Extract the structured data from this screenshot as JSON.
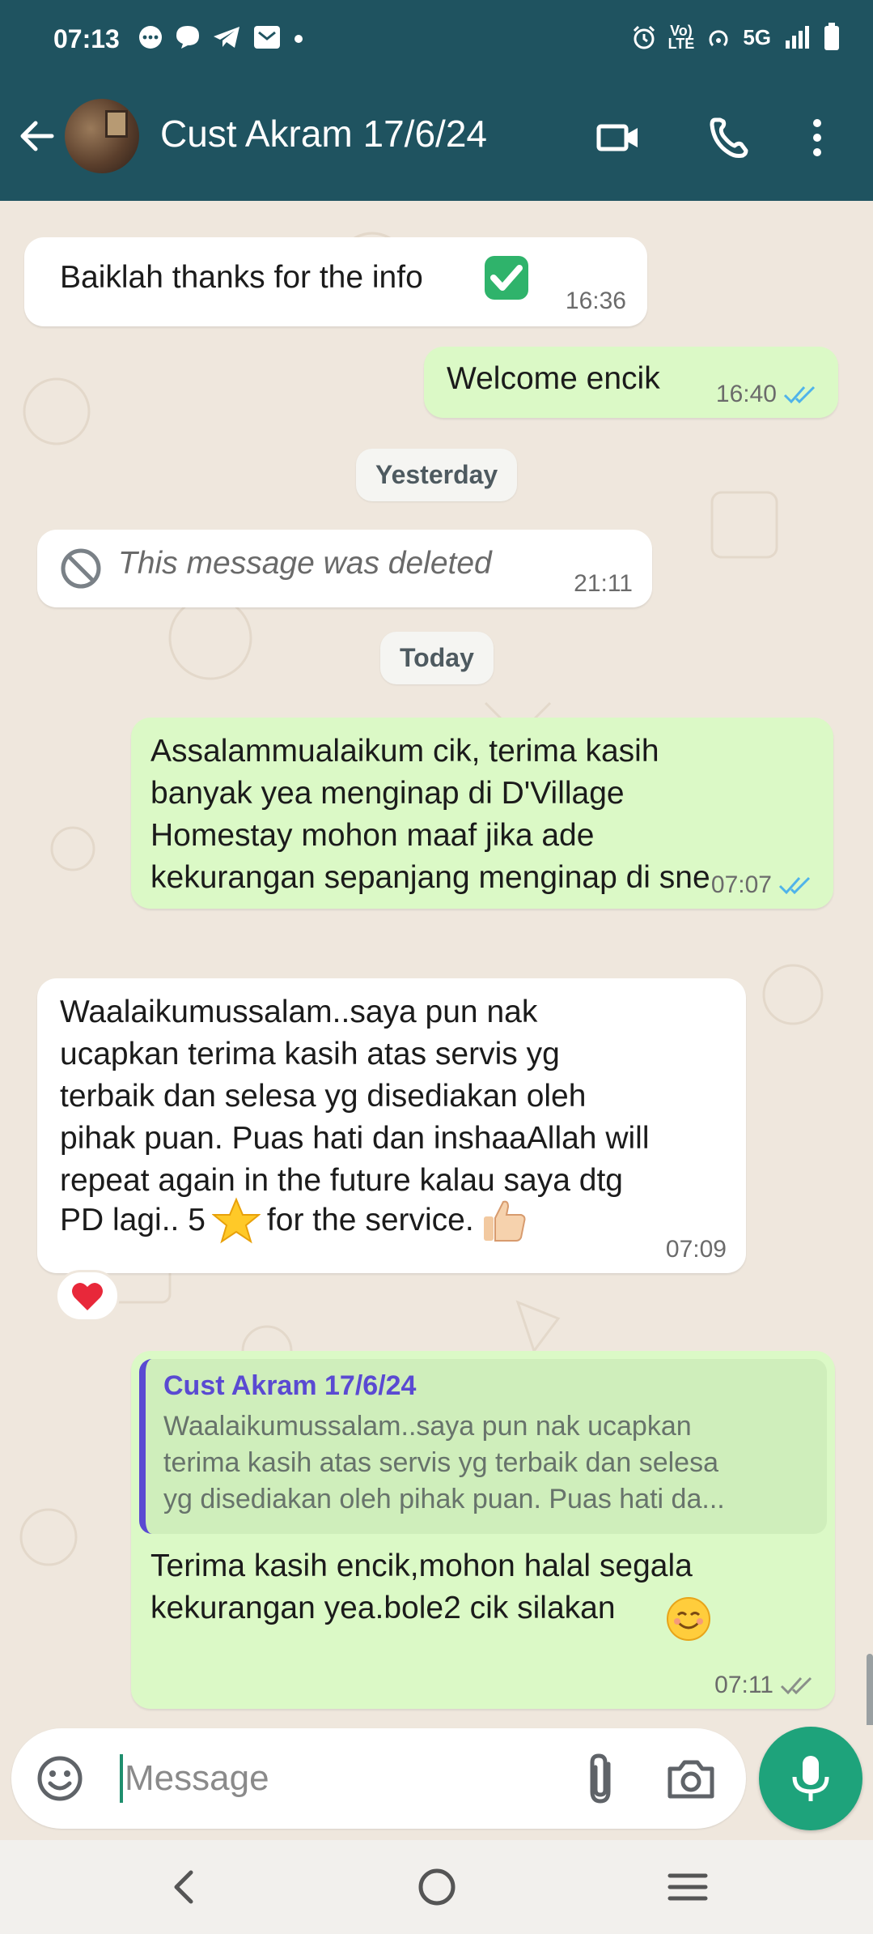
{
  "status_bar": {
    "time": "07:13",
    "network": "5G",
    "lte_label": "LTE"
  },
  "header": {
    "contact_name": "Cust Akram 17/6/24"
  },
  "messages": [
    {
      "dir": "in",
      "text": "Baiklah thanks for the info",
      "time": "16:36"
    },
    {
      "dir": "out",
      "text": "Welcome encik",
      "time": "16:40"
    },
    {
      "dir": "date",
      "text": "Yesterday"
    },
    {
      "dir": "in",
      "deleted": true,
      "text": "This message was deleted",
      "time": "21:11"
    },
    {
      "dir": "date",
      "text": "Today"
    },
    {
      "dir": "out",
      "text": "Assalammualaikum cik, terima kasih\nbanyak yea menginap di D'Village\nHomestay mohon maaf jika ade\nkekurangan sepanjang menginap di sne",
      "time": "07:07"
    },
    {
      "dir": "in",
      "text": "Waalaikumussalam..saya pun nak\nucapkan terima kasih atas servis yg\nterbaik dan selesa yg disediakan oleh\npihak puan. Puas hati dan inshaaAllah will\nrepeat again in the future kalau saya dtg",
      "text_last_pre": "PD lagi.. 5",
      "text_last_post": "for the service.",
      "time": "07:09",
      "reaction": "heart"
    },
    {
      "dir": "out",
      "quoted_name": "Cust Akram 17/6/24",
      "quoted_text": "Waalaikumussalam..saya pun nak ucapkan\nterima kasih atas servis yg terbaik dan selesa\nyg disediakan oleh pihak puan. Puas hati da...",
      "text": "Terima kasih encik,mohon halal segala\nkekurangan yea.bole2 cik silakan",
      "time": "07:11"
    }
  ],
  "composer": {
    "placeholder": "Message"
  },
  "colors": {
    "header_bg": "#1f5360",
    "incoming": "#ffffff",
    "outgoing": "#dbf9c6",
    "read_tick": "#4fb3ea",
    "mic_button": "#1ea37b",
    "quote_accent": "#5a4ad2"
  },
  "icons": [
    "back-arrow-icon",
    "video-call-icon",
    "phone-icon",
    "more-vert-icon",
    "emoji-icon",
    "attach-icon",
    "camera-icon",
    "mic-icon",
    "check-box-emoji",
    "star-emoji",
    "thumbs-up-emoji",
    "heart-emoji",
    "smile-emoji",
    "block-icon"
  ]
}
